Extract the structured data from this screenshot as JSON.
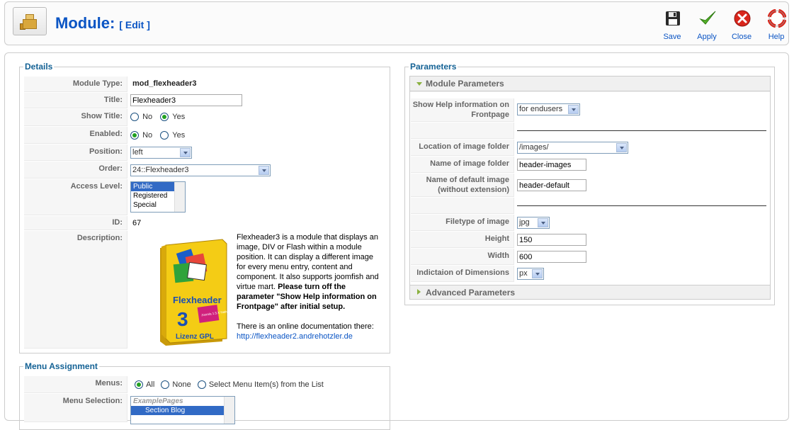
{
  "header": {
    "title": "Module:",
    "subtitle": "[ Edit ]",
    "icon": "module-icon"
  },
  "toolbar": {
    "save_label": "Save",
    "apply_label": "Apply",
    "close_label": "Close",
    "help_label": "Help"
  },
  "details": {
    "legend": "Details",
    "module_type_label": "Module Type:",
    "module_type_value": "mod_flexheader3",
    "title_label": "Title:",
    "title_value": "Flexheader3",
    "show_title_label": "Show Title:",
    "show_title_options": [
      "No",
      "Yes"
    ],
    "show_title_selected": "Yes",
    "enabled_label": "Enabled:",
    "enabled_options": [
      "No",
      "Yes"
    ],
    "enabled_selected": "No",
    "position_label": "Position:",
    "position_value": "left",
    "order_label": "Order:",
    "order_value": "24::Flexheader3",
    "access_label": "Access Level:",
    "access_options": [
      "Public",
      "Registered",
      "Special"
    ],
    "access_selected": "Public",
    "id_label": "ID:",
    "id_value": "67",
    "description_label": "Description:",
    "description_text": "Flexheader3 is a module that displays an image, DIV or Flash within a module position. It can display a different image for every menu entry, content and component. It also supports joomfish and virtue mart.",
    "description_bold": "Please turn off the parameter \"Show Help information on Frontpage\" after initial setup.",
    "description_doc": "There is an online documentation there:",
    "description_link": "http://flexheader2.andrehotzler.de",
    "product_box": {
      "brand": "Flexheader",
      "number": "3",
      "license": "Lizenz GPL",
      "badge": "Joomla 1.5.X Native"
    }
  },
  "menu_assignment": {
    "legend": "Menu Assignment",
    "menus_label": "Menus:",
    "menus_options": [
      "All",
      "None",
      "Select Menu Item(s) from the List"
    ],
    "menus_selected": "All",
    "menu_selection_label": "Menu Selection:",
    "menu_selection_items": [
      "ExamplePages",
      "Section Blog"
    ]
  },
  "parameters": {
    "legend": "Parameters",
    "module_params_title": "Module Parameters",
    "advanced_params_title": "Advanced Parameters",
    "show_help_label": "Show Help information on Frontpage",
    "show_help_value": "for endusers",
    "location_label": "Location of image folder",
    "location_value": "/images/",
    "name_folder_label": "Name of image folder",
    "name_folder_value": "header-images",
    "default_image_label": "Name of default image (without extension)",
    "default_image_value": "header-default",
    "filetype_label": "Filetype of image",
    "filetype_value": "jpg",
    "height_label": "Height",
    "height_value": "150",
    "width_label": "Width",
    "width_value": "600",
    "dimensions_label": "Indictaion of Dimensions",
    "dimensions_value": "px"
  },
  "colors": {
    "brand_blue": "#0b55c4",
    "legend_blue": "#146295",
    "pane_arrow_green": "#8ab13f"
  }
}
